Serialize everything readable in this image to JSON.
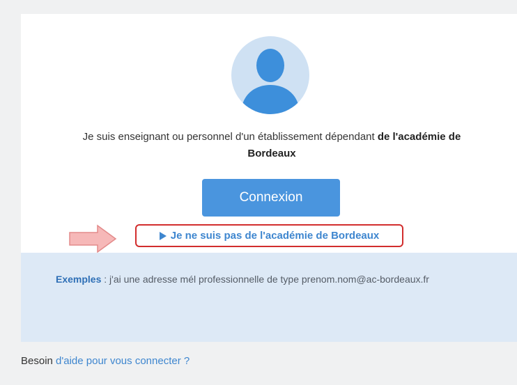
{
  "card": {
    "intro_text": "Je suis enseignant ou personnel d'un établissement dépendant",
    "intro_bold": "de l'académie de Bordeaux",
    "login_button": "Connexion",
    "other_academy_link": "Je ne suis pas de l'académie de Bordeaux"
  },
  "examples": {
    "label": "Exemples",
    "text": " : j'ai une adresse mél professionnelle de type prenom.nom@ac-bordeaux.fr"
  },
  "help": {
    "prefix": "Besoin ",
    "link": "d'aide pour vous connecter ?"
  },
  "colors": {
    "accent": "#4a95de",
    "link": "#3e86cf",
    "highlight_border": "#d22d2d",
    "examples_bg": "#dde9f6",
    "avatar_bg": "#cfe1f3",
    "avatar_figure": "#3d8fdb",
    "arrow": "#f6b8b8"
  },
  "icons": {
    "avatar": "user-silhouette-icon",
    "link_marker": "play-triangle-icon",
    "pointer": "right-arrow-icon"
  }
}
